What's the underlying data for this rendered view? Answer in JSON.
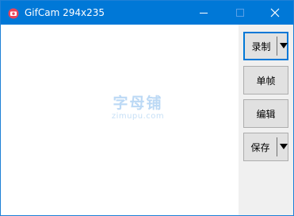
{
  "window": {
    "title": "GifCam 294x235",
    "app_icon": "gifcam-icon",
    "controls": [
      "minimize-icon",
      "maximize-icon",
      "close-icon"
    ]
  },
  "watermark": {
    "text_cn": "字母铺",
    "text_en": "zimupu.com"
  },
  "toolbar": {
    "record_label": "录制",
    "frame_label": "单帧",
    "edit_label": "编辑",
    "save_label": "保存"
  },
  "colors": {
    "titlebar": "#0078d7",
    "focus_border": "#0078d7",
    "button_face": "#e1e1e1",
    "panel_background": "#f0f0f0",
    "watermark": "#bcd9f5"
  }
}
